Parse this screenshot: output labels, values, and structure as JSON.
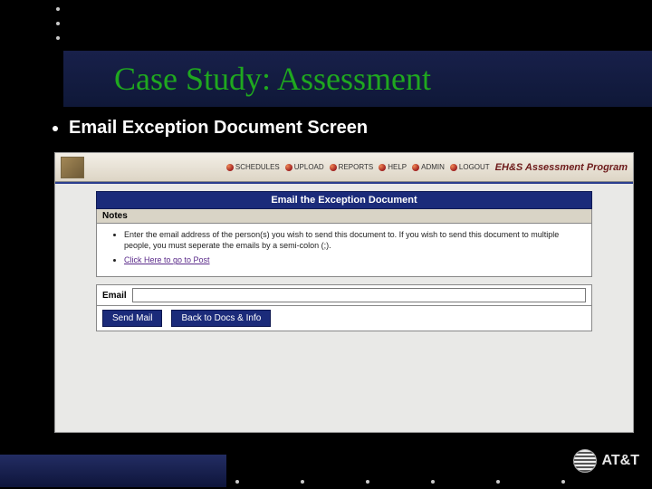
{
  "slide": {
    "title": "Case Study: Assessment",
    "subtitle": "Email Exception Document Screen"
  },
  "app": {
    "program_title": "EH&S Assessment Program",
    "nav": {
      "schedules": "SCHEDULES",
      "upload": "UPLOAD",
      "reports": "REPORTS",
      "help": "HELP",
      "admin": "ADMIN",
      "logout": "LOGOUT"
    },
    "banner": "Email the Exception Document",
    "notes_label": "Notes",
    "note1": "Enter the email address of the person(s) you wish to send this document to. If you wish to send this document to multiple people, you must seperate the emails by a semi-colon (;).",
    "note2_link": "Click Here to go to Post",
    "email_label": "Email",
    "email_value": "",
    "buttons": {
      "send": "Send Mail",
      "back": "Back to Docs & Info"
    }
  },
  "footer": {
    "brand": "AT&T"
  }
}
